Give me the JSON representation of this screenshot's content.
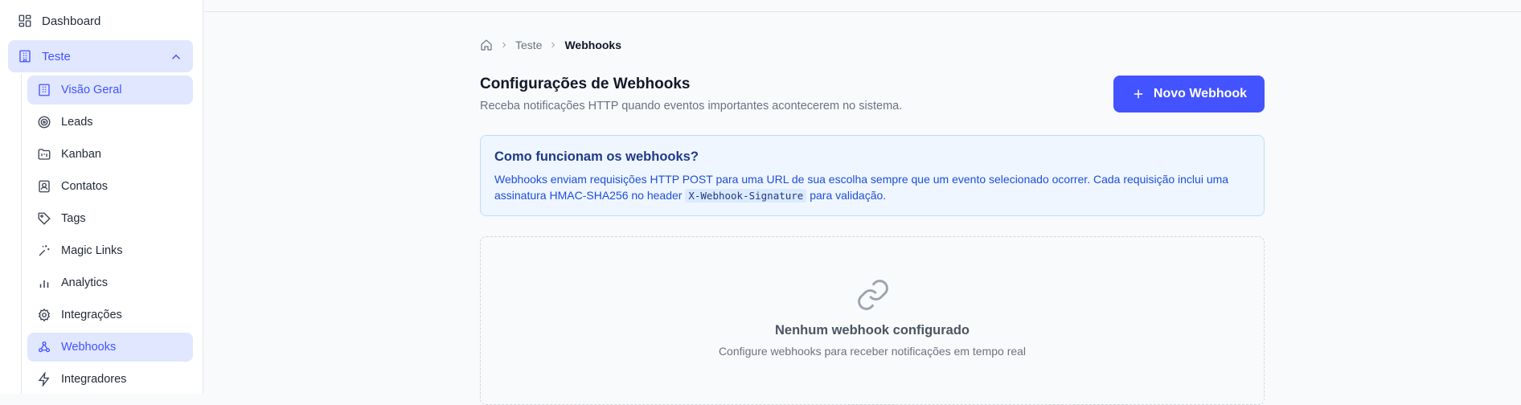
{
  "sidebar": {
    "dashboard": {
      "label": "Dashboard",
      "icon": "dashboard-icon"
    },
    "group": {
      "label": "Teste",
      "icon": "building-icon"
    },
    "items": [
      {
        "label": "Visão Geral",
        "icon": "building-icon",
        "active": true
      },
      {
        "label": "Leads",
        "icon": "target-icon",
        "active": false
      },
      {
        "label": "Kanban",
        "icon": "kanban-icon",
        "active": false
      },
      {
        "label": "Contatos",
        "icon": "contact-icon",
        "active": false
      },
      {
        "label": "Tags",
        "icon": "tag-icon",
        "active": false
      },
      {
        "label": "Magic Links",
        "icon": "sparkles-icon",
        "active": false
      },
      {
        "label": "Analytics",
        "icon": "bar-chart-icon",
        "active": false
      },
      {
        "label": "Integrações",
        "icon": "gear-icon",
        "active": false
      },
      {
        "label": "Webhooks",
        "icon": "webhook-icon",
        "active": true
      },
      {
        "label": "Integradores",
        "icon": "zap-icon",
        "active": false
      }
    ]
  },
  "breadcrumb": {
    "parent": "Teste",
    "current": "Webhooks"
  },
  "header": {
    "title": "Configurações de Webhooks",
    "subtitle": "Receba notificações HTTP quando eventos importantes acontecerem no sistema.",
    "new_button": "Novo Webhook"
  },
  "info": {
    "title": "Como funcionam os webhooks?",
    "text_before": "Webhooks enviam requisições HTTP POST para uma URL de sua escolha sempre que um evento selecionado ocorrer. Cada requisição inclui uma assinatura HMAC-SHA256 no header ",
    "code": "X-Webhook-Signature",
    "text_after": " para validação."
  },
  "empty": {
    "title": "Nenhum webhook configurado",
    "text": "Configure webhooks para receber notificações em tempo real"
  },
  "colors": {
    "accent": "#4353ff",
    "active_bg": "#e0e7ff",
    "info_bg": "#eff6ff"
  }
}
